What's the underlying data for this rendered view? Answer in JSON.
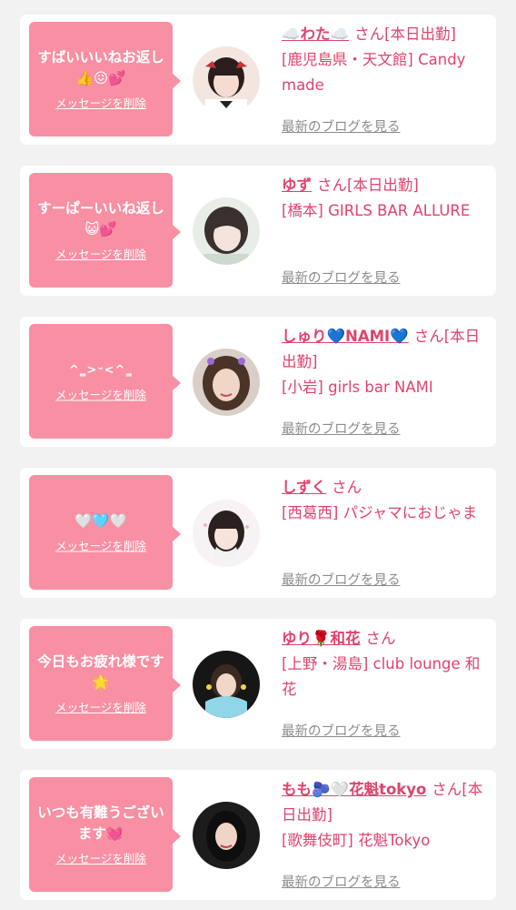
{
  "delete_label": "メッセージを削除",
  "blog_label": "最新のブログを見る",
  "colors": {
    "bubble": "#f98fa2",
    "accent": "#e0436d",
    "muted": "#8c8c8c",
    "background": "#f2f2f2"
  },
  "cards": [
    {
      "message": "すばいいいねお返し👍😖💕",
      "name": "☁️わた☁️",
      "suffix": "さん[本日出勤]",
      "shop": "[鹿児島県・天文館] Candy made"
    },
    {
      "message": "すーぱーいいね返し😺💕",
      "name": "ゆず",
      "suffix": "さん[本日出勤]",
      "shop": "[橋本] GIRLS BAR ALLURE"
    },
    {
      "message": "^‗>ᵕ<^‗",
      "name": "しゅり💙NAMI💙",
      "suffix": "さん[本日出勤]",
      "shop": "[小岩] girls bar NAMI"
    },
    {
      "message": "🤍🩵🤍",
      "name": "しずく",
      "suffix": "さん",
      "shop": "[西葛西] パジャマにおじゃま"
    },
    {
      "message": "今日もお疲れ様です🌟",
      "name": "ゆり🌹和花",
      "suffix": "さん",
      "shop": "[上野・湯島] club lounge 和花"
    },
    {
      "message": "いつも有難うございます💓",
      "name": "もも🫐🤍花魁tokyo",
      "suffix": "さん[本日出勤]",
      "shop": "[歌舞伎町] 花魁Tokyo"
    }
  ]
}
